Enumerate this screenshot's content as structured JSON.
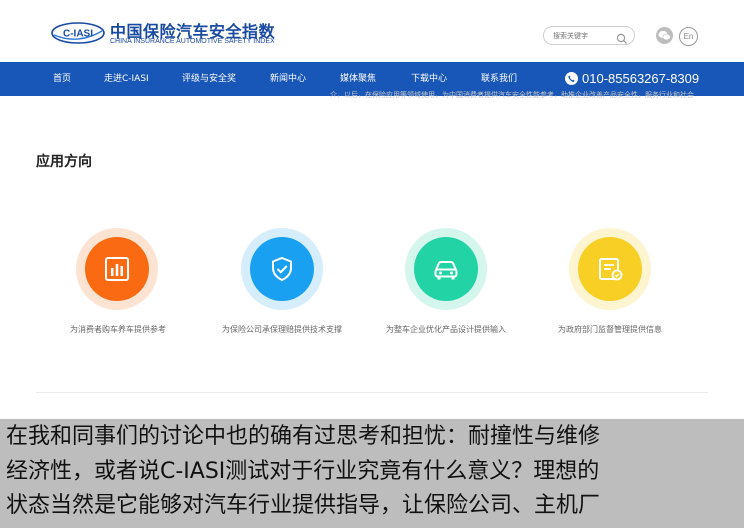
{
  "header": {
    "logo_text": "C-IASI",
    "brand_cn": "中国保险汽车安全指数",
    "brand_en": "CHINA INSURANCE AUTOMOTIVE SAFETY INDEX",
    "search_placeholder": "搜索关键字",
    "lang_label": "En"
  },
  "nav": {
    "items": [
      "首页",
      "走进C-IASI",
      "评级与安全奖",
      "新闻中心",
      "媒体聚焦",
      "下载中心",
      "联系我们"
    ],
    "phone": "010-85563267-8309",
    "bg_color": "#1857b8"
  },
  "cut_text": "介，以后，在保险应用等领域使用，为中国消费者提供汽车安全性能参考，助推企业改善产品安全性，服务行业和社会",
  "main": {
    "section_title": "应用方向",
    "items": [
      {
        "caption": "为消费者购车养车提供参考",
        "icon": "bar-chart-icon",
        "color": "#fa6a13"
      },
      {
        "caption": "为保险公司承保理赔提供技术支撑",
        "icon": "shield-check-icon",
        "color": "#1aa0f0"
      },
      {
        "caption": "为整车企业优化产品设计提供输入",
        "icon": "car-icon",
        "color": "#22d3a6"
      },
      {
        "caption": "为政府部门监督管理提供信息",
        "icon": "certificate-icon",
        "color": "#f8cf24"
      }
    ]
  },
  "subtitles": [
    "在我和同事们的讨论中也的确有过思考和担忧：耐撞性与维修",
    "经济性，或者说C-IASI测试对于行业究竟有什么意义？理想的",
    "状态当然是它能够对汽车行业提供指导，让保险公司、主机厂"
  ]
}
